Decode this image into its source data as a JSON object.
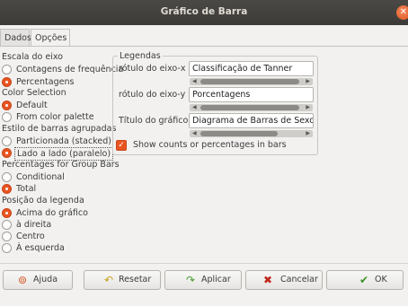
{
  "window": {
    "title": "Gráfico de Barra"
  },
  "tabs": [
    {
      "label": "Dados"
    },
    {
      "label": "Opções"
    }
  ],
  "sections": {
    "axis_scale": {
      "label": "Escala do eixo",
      "options": [
        {
          "label": "Contagens de frequência",
          "checked": false
        },
        {
          "label": "Percentagens",
          "checked": true
        }
      ]
    },
    "color_selection": {
      "label": "Color Selection",
      "options": [
        {
          "label": "Default",
          "checked": true
        },
        {
          "label": "From color palette",
          "checked": false
        }
      ]
    },
    "grouped_style": {
      "label": "Estilo de barras agrupadas",
      "options": [
        {
          "label": "Particionada (stacked)",
          "checked": false
        },
        {
          "label": "Lado a lado (paralelo)",
          "checked": true
        }
      ]
    },
    "group_percentages": {
      "label": "Percentages for Group Bars",
      "options": [
        {
          "label": "Conditional",
          "checked": false
        },
        {
          "label": "Total",
          "checked": true
        }
      ]
    },
    "legend_position": {
      "label": "Posição da legenda",
      "options": [
        {
          "label": "Acima do gráfico",
          "checked": true
        },
        {
          "label": "à direita",
          "checked": false
        },
        {
          "label": "Centro",
          "checked": false
        },
        {
          "label": "À esquerda",
          "checked": false
        }
      ]
    }
  },
  "legends": {
    "title": "Legendas",
    "x_label": {
      "label": "rótulo do eixo-x",
      "value": "Classificação de Tanner"
    },
    "y_label": {
      "label": "rótulo do eixo-y",
      "value": "Porcentagens"
    },
    "graph_title": {
      "label": "Título do gráfico",
      "value": "Diagrama de Barras de Sexo por"
    },
    "show_counts": {
      "label": "Show counts or percentages in bars",
      "checked": true
    }
  },
  "buttons": {
    "help": "Ajuda",
    "reset": "Resetar",
    "apply": "Aplicar",
    "cancel": "Cancelar",
    "ok": "OK"
  },
  "colors": {
    "accent": "#e95420",
    "titlebar": "#3c3b37",
    "background": "#f2f1f0"
  }
}
